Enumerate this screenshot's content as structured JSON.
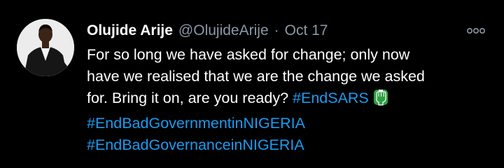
{
  "tweet": {
    "author_name": "Olujide Arije",
    "handle": "@OlujideArije",
    "separator": "·",
    "date": "Oct 17",
    "more_icon": "more-options-icon",
    "text_lines": [
      "For so long we have asked for change; only now",
      "have we realised that we are the change we asked",
      "for. Bring it on, are you ready?"
    ],
    "hashtags": [
      "#EndSARS",
      "#EndBadGovernmentinNIGERIA",
      "#EndBadGovernanceinNIGERIA"
    ],
    "emoji_icon": "green-fist-flag-icon"
  },
  "colors": {
    "background": "#000000",
    "text": "#ffffff",
    "secondary": "#8b98a5",
    "link": "#1d9bf0",
    "emoji_green": "#2e9e44"
  }
}
